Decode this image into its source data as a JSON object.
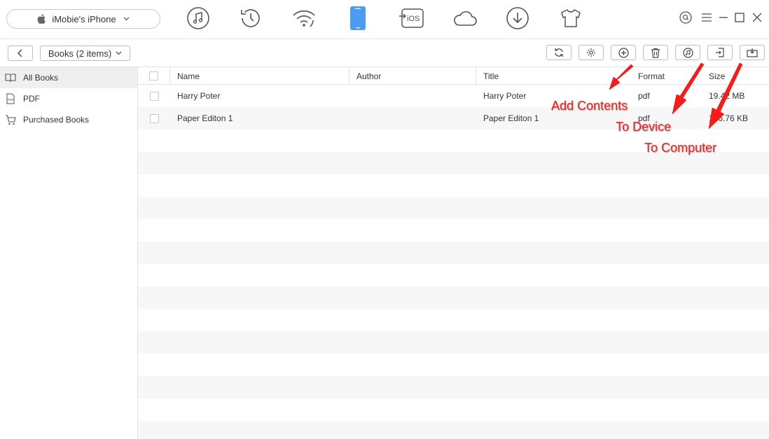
{
  "header": {
    "device_name": "iMobie's iPhone",
    "nav_icons": [
      "music-icon",
      "history-icon",
      "wifi-icon",
      "phone-icon",
      "to-ios-icon",
      "cloud-icon",
      "download-icon",
      "tshirt-icon"
    ],
    "nav_to_ios_label": "iOS",
    "active_nav": "phone-icon",
    "accent_color": "#4a9df0"
  },
  "toolbar": {
    "category_label": "Books (2 items)",
    "buttons": [
      "refresh-icon",
      "settings-icon",
      "add-icon",
      "delete-icon",
      "to-device-icon",
      "to-computer-icon",
      "export-icon"
    ]
  },
  "sidebar": {
    "items": [
      {
        "label": "All Books",
        "icon": "book-icon",
        "active": true
      },
      {
        "label": "PDF",
        "icon": "pdf-icon",
        "active": false
      },
      {
        "label": "Purchased Books",
        "icon": "cart-icon",
        "active": false
      }
    ]
  },
  "table": {
    "columns": [
      "Name",
      "Author",
      "Title",
      "Format",
      "Size"
    ],
    "rows": [
      {
        "name": "Harry Poter",
        "author": "",
        "title": "Harry Poter",
        "format": "pdf",
        "size": "19.42 MB"
      },
      {
        "name": "Paper Editon 1",
        "author": "",
        "title": "Paper Editon 1",
        "format": "pdf",
        "size": "146.76 KB"
      }
    ]
  },
  "annotations": {
    "add_contents": "Add Contents",
    "to_device": "To Device",
    "to_computer": "To Computer",
    "color": "#ff1a1a"
  }
}
